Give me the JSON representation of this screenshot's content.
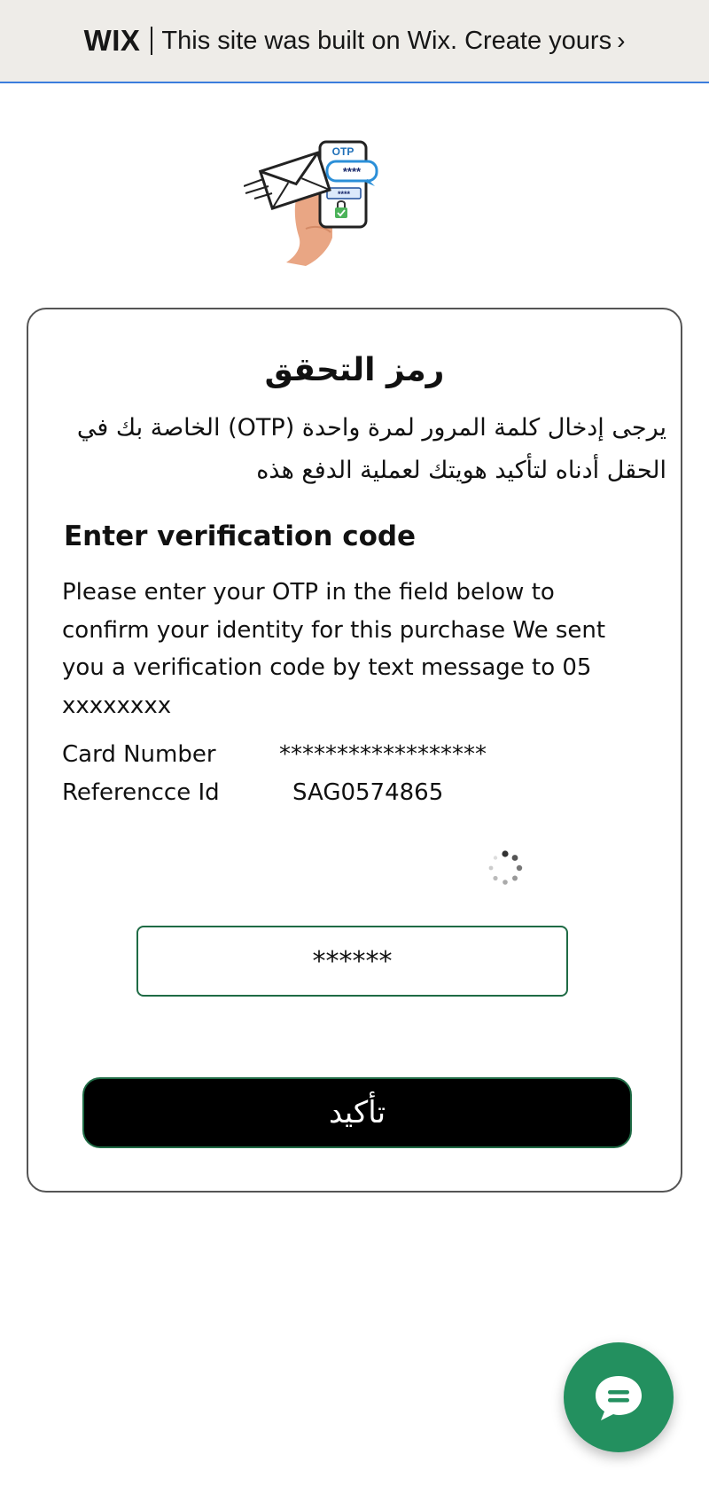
{
  "banner": {
    "logo": "WIX",
    "text": "This site was built on Wix. Create yours",
    "chevron": "›"
  },
  "illustration": {
    "otp_label": "OTP",
    "bubble_text": "****",
    "field_text": "****",
    "icon": "otp-phone-illustration"
  },
  "card": {
    "title_ar": "رمز التحقق",
    "intro_ar": "يرجى إدخال كلمة المرور لمرة واحدة (OTP) الخاصة بك في الحقل أدناه لتأكيد هويتك لعملية الدفع هذه",
    "heading": "Enter verification code",
    "instructions": "Please enter your OTP in the field below to confirm your identity for this purchase We sent you a verification code by text message to 05 xxxxxxxx",
    "card_number_label": "Card Number",
    "card_number_value": "******************",
    "reference_label": "Referencce Id",
    "reference_value": "SAG0574865",
    "otp_value": "******",
    "confirm_label": "تأكيد"
  },
  "colors": {
    "banner_bg": "#eeece8",
    "banner_border": "#3b7ddd",
    "accent_green": "#1f6b45",
    "chat_green": "#23905f",
    "button_bg": "#000000"
  },
  "chat": {
    "icon": "chat-bubble-icon"
  }
}
